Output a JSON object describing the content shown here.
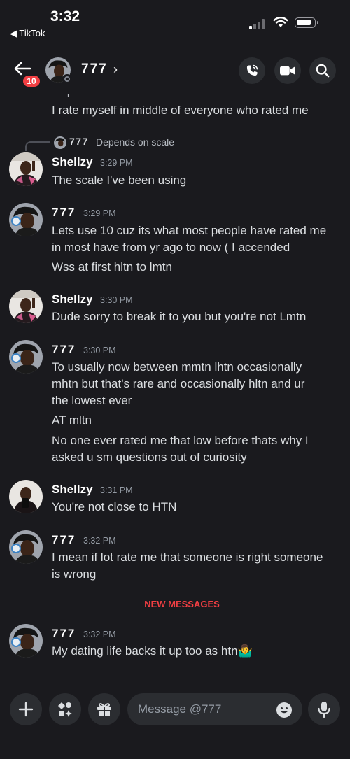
{
  "status_bar": {
    "time": "3:32",
    "back_app": "◀ TikTok"
  },
  "header": {
    "unread_badge": "10",
    "channel_name": "777",
    "icons": [
      "back-arrow-icon",
      "phone-call-icon",
      "video-camera-icon",
      "search-icon"
    ]
  },
  "messages": {
    "cut_text": "Depends on scale",
    "m0_line": "I rate myself in middle of everyone who rated me",
    "reply": {
      "author": "777",
      "text": "Depends on scale"
    },
    "m1": {
      "author": "Shellzy",
      "time": "3:29 PM",
      "lines": [
        "The scale I've been using"
      ]
    },
    "m2": {
      "author": "777",
      "time": "3:29 PM",
      "lines": [
        "Lets use 10 cuz its what most people have rated me",
        "in most have from yr ago to now ( I accended",
        "Wss at first hltn to lmtn"
      ]
    },
    "m3": {
      "author": "Shellzy",
      "time": "3:30 PM",
      "lines": [
        "Dude sorry to break it to you but you're not Lmtn"
      ]
    },
    "m4": {
      "author": "777",
      "time": "3:30 PM",
      "lines": [
        "To usually now between mmtn lhtn occasionally",
        "mhtn but that's rare and occasionally hltn and ur",
        "the lowest ever",
        "AT mltn",
        "No one ever rated me that low before thats why I",
        "asked u sm questions out of curiosity"
      ]
    },
    "m5": {
      "author": "Shellzy",
      "time": "3:31 PM",
      "lines": [
        "You're not close to HTN"
      ]
    },
    "m6": {
      "author": "777",
      "time": "3:32 PM",
      "lines": [
        "I mean if lot rate me that someone is right someone",
        "is wrong"
      ]
    },
    "new_messages_label": "NEW MESSAGES",
    "m7": {
      "author": "777",
      "time": "3:32 PM",
      "lines": [
        "My dating life backs it up too as htn🤷‍♂️"
      ]
    }
  },
  "composer": {
    "placeholder": "Message @777",
    "icons": [
      "plus-icon",
      "apps-icon",
      "gift-icon",
      "emoji-icon",
      "microphone-icon"
    ]
  },
  "colors": {
    "background": "#1a1a1e",
    "button_bg": "#2b2d31",
    "accent_red": "#f23f43",
    "text": "#dbdee1",
    "muted": "#949ba4"
  }
}
